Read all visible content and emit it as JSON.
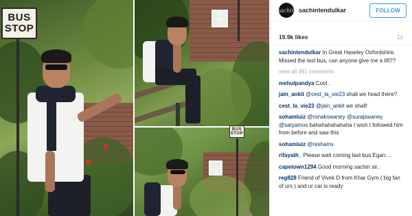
{
  "photo": {
    "sign_text_line1": "BUS",
    "sign_text_line2": "STOP",
    "small_sign_line1": "BUS",
    "small_sign_line2": "STOP"
  },
  "header": {
    "avatar_text": "sachin",
    "username": "sachintendulkar",
    "follow_label": "FOLLOW"
  },
  "meta": {
    "likes": "19.9k likes",
    "age": "1d"
  },
  "caption": {
    "user": "sachintendulkar",
    "text": " In Great Haseley Oxfordshire. Missed the last bus, can anyone give me a lift??"
  },
  "view_all": "view all 461 comments",
  "comments": [
    {
      "user": "mehulpandya",
      "mention": "",
      "text": " Cool.."
    },
    {
      "user": "jain_ankit",
      "mention": " @cest_la_vie23",
      "text": " shall we head there?"
    },
    {
      "user": "cest_la_vie23",
      "mention": " @jain_ankit",
      "text": " we shall!"
    },
    {
      "user": "sohamluiz",
      "mention": " @ronakswaney @surajswaney @satyamos",
      "text": " bahahahahahaha I wish I followed him from before and saw this"
    },
    {
      "user": "sohamluiz",
      "mention": " @reshamv",
      "text": ""
    },
    {
      "user": "rifayath_",
      "mention": "",
      "text": " Please wait coming last bus Egan. .."
    },
    {
      "user": "capetown1294",
      "mention": "",
      "text": " Good morning sachin sir.."
    },
    {
      "user": "reg828",
      "mention": "",
      "text": " Friend of Vivek D from Khar Gym ( big fan of urs ) and ur car is ready"
    }
  ]
}
